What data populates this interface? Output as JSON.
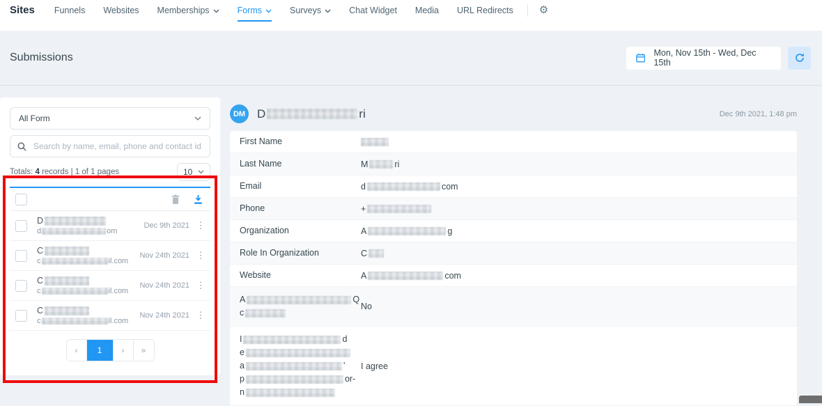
{
  "nav": {
    "brand": "Sites",
    "items": [
      {
        "label": "Funnels"
      },
      {
        "label": "Websites"
      },
      {
        "label": "Memberships",
        "dropdown": true
      },
      {
        "label": "Forms",
        "dropdown": true,
        "active": true
      },
      {
        "label": "Surveys",
        "dropdown": true
      },
      {
        "label": "Chat Widget"
      },
      {
        "label": "Media"
      },
      {
        "label": "URL Redirects"
      }
    ]
  },
  "icons": {
    "gear": "⚙",
    "kebab": "⋮"
  },
  "header": {
    "title": "Submissions",
    "date_range": "Mon, Nov 15th - Wed, Dec 15th"
  },
  "filters": {
    "form_select": "All Form",
    "search_placeholder": "Search by name, email, phone and contact id",
    "totals_label": "Totals:",
    "totals_count": "4",
    "totals_rest": "records | 1 of 1 pages",
    "page_size": "10"
  },
  "list": {
    "rows": [
      {
        "name_prefix": "D",
        "email_prefix": "d",
        "email_suffix": "om",
        "date": "Dec 9th 2021"
      },
      {
        "name_prefix": "C",
        "email_prefix": "c",
        "email_suffix": "il.com",
        "date": "Nov 24th 2021"
      },
      {
        "name_prefix": "C",
        "email_prefix": "c",
        "email_suffix": "il.com",
        "date": "Nov 24th 2021"
      },
      {
        "name_prefix": "C",
        "email_prefix": "c",
        "email_suffix": "il.com",
        "date": "Nov 24th 2021"
      }
    ],
    "pagination": {
      "prev": "‹",
      "page": "1",
      "next": "›",
      "last": "»"
    }
  },
  "detail": {
    "avatar": "DM",
    "name_prefix": "D",
    "name_suffix": "ri",
    "timestamp": "Dec 9th 2021, 1:48 pm",
    "fields": [
      {
        "label": "First Name"
      },
      {
        "label": "Last Name",
        "value_prefix": "M",
        "value_suffix": "ri"
      },
      {
        "label": "Email",
        "value_prefix": "d",
        "value_suffix": "com"
      },
      {
        "label": "Phone",
        "value_prefix": "+"
      },
      {
        "label": "Organization",
        "value_prefix": "A",
        "value_suffix": "g"
      },
      {
        "label": "Role In Organization",
        "value_prefix": "C"
      },
      {
        "label": "Website",
        "value_prefix": "A",
        "value_suffix": "com"
      },
      {
        "label_line1_prefix": "A",
        "label_line1_suffix": "Q",
        "label_line2_prefix": "c",
        "value": "No"
      },
      {
        "label_lines": [
          {
            "prefix": "I",
            "suffix": "d"
          },
          {
            "prefix": "e",
            "suffix": ""
          },
          {
            "prefix": "a",
            "suffix": "'"
          },
          {
            "prefix": "p",
            "suffix": "or-"
          },
          {
            "prefix": "n",
            "suffix": ""
          }
        ],
        "value": "I agree"
      }
    ]
  }
}
